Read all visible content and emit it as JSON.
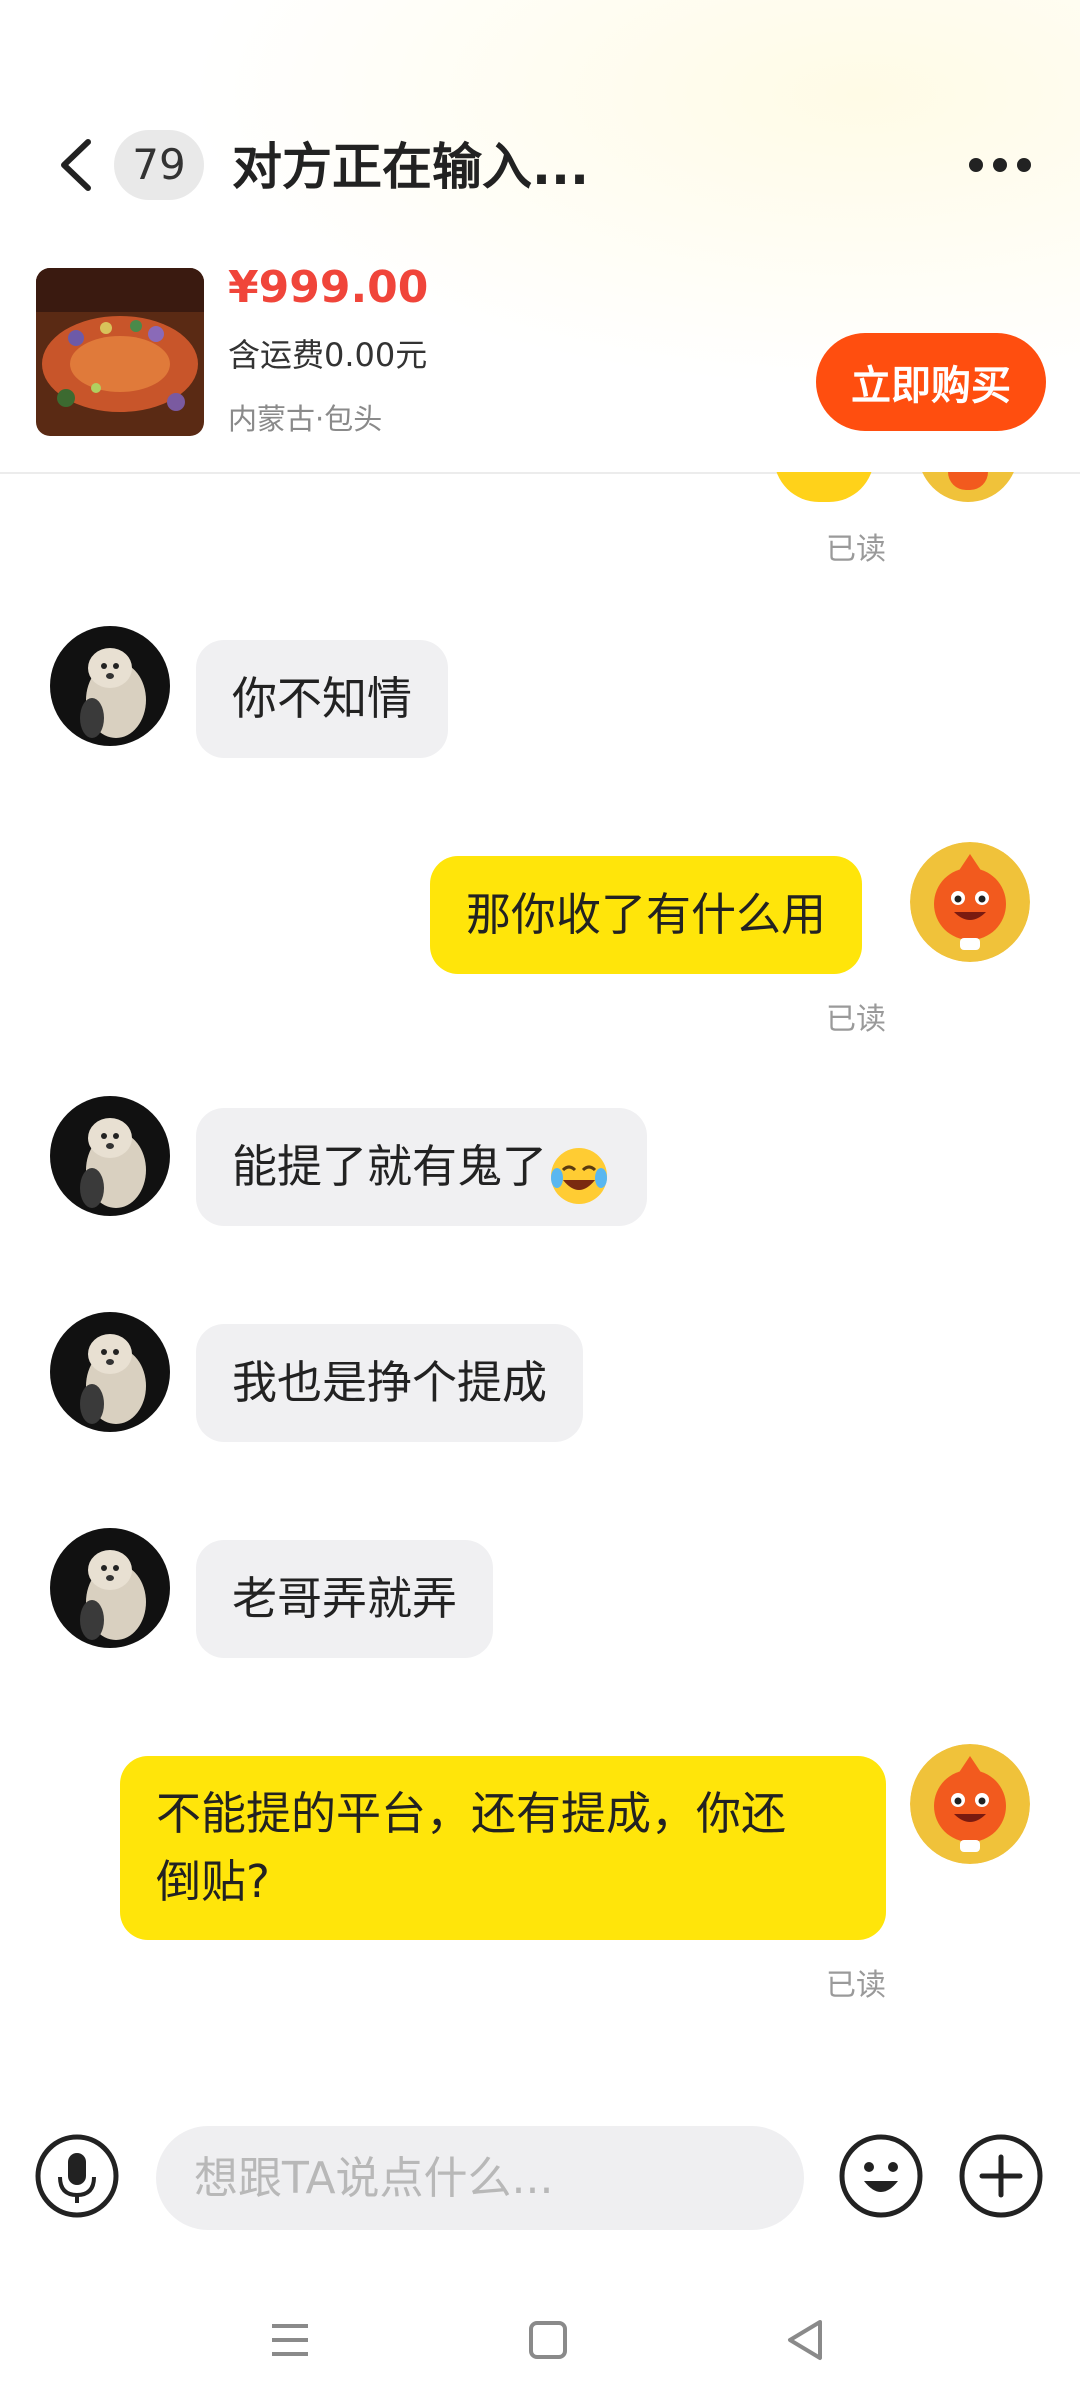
{
  "header": {
    "unread_count": "79",
    "title": "对方正在输入..."
  },
  "product": {
    "price": "¥999.00",
    "shipping": "含运费0.00元",
    "location": "内蒙古·包头",
    "buy_label": "立即购买"
  },
  "messages": [
    {
      "side": "out",
      "type": "read_receipt",
      "read_label": "已读"
    },
    {
      "side": "in",
      "text": "你不知情"
    },
    {
      "side": "out",
      "text": "那你收了有什么用",
      "read_label": "已读"
    },
    {
      "side": "in",
      "text": "能提了就有鬼了",
      "emoji": "crying-laughing-emoji"
    },
    {
      "side": "in",
      "text": "我也是挣个提成"
    },
    {
      "side": "in",
      "text": "老哥弄就弄"
    },
    {
      "side": "out",
      "text_line1": "不能提的平台，还有提成，你还",
      "text_line2": "倒贴?",
      "read_label": "已读"
    }
  ],
  "composer": {
    "placeholder": "想跟TA说点什么..."
  },
  "colors": {
    "accent_orange": "#ff4e0f",
    "price_red": "#f0453a",
    "outgoing_bubble": "#ffe50a",
    "incoming_bubble": "#f0f0f2"
  },
  "icons": [
    "back-icon",
    "more-icon",
    "microphone-icon",
    "emoji-icon",
    "plus-icon",
    "menu-nav-icon",
    "home-nav-icon",
    "back-nav-icon"
  ]
}
